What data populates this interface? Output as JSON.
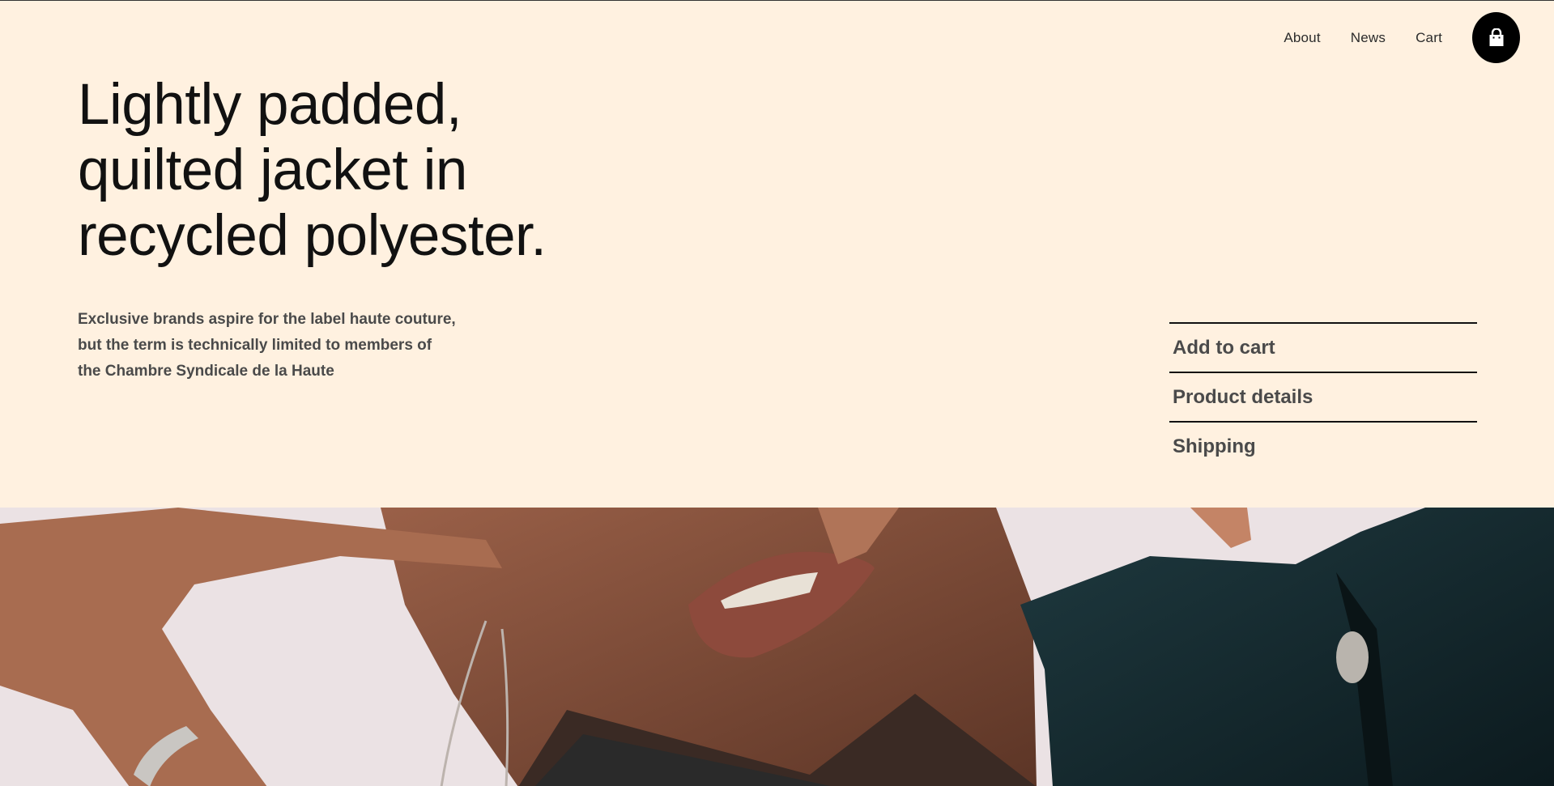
{
  "nav": {
    "items": [
      "About",
      "News",
      "Cart"
    ],
    "cart_icon": "shopping-bag-icon"
  },
  "hero": {
    "headline_lines": [
      "Lightly padded,",
      "quilted jacket in",
      "recycled polyester."
    ],
    "lede": "Exclusive brands aspire for the label haute couture, but the term is technically limited to members of the Chambre Syndicale de la Haute"
  },
  "accordion": {
    "items": [
      "Add to cart",
      "Product details",
      "Shipping"
    ]
  },
  "colors": {
    "background": "#fff1e0",
    "text": "#111111",
    "muted": "#4a4a4a",
    "button": "#000000"
  }
}
